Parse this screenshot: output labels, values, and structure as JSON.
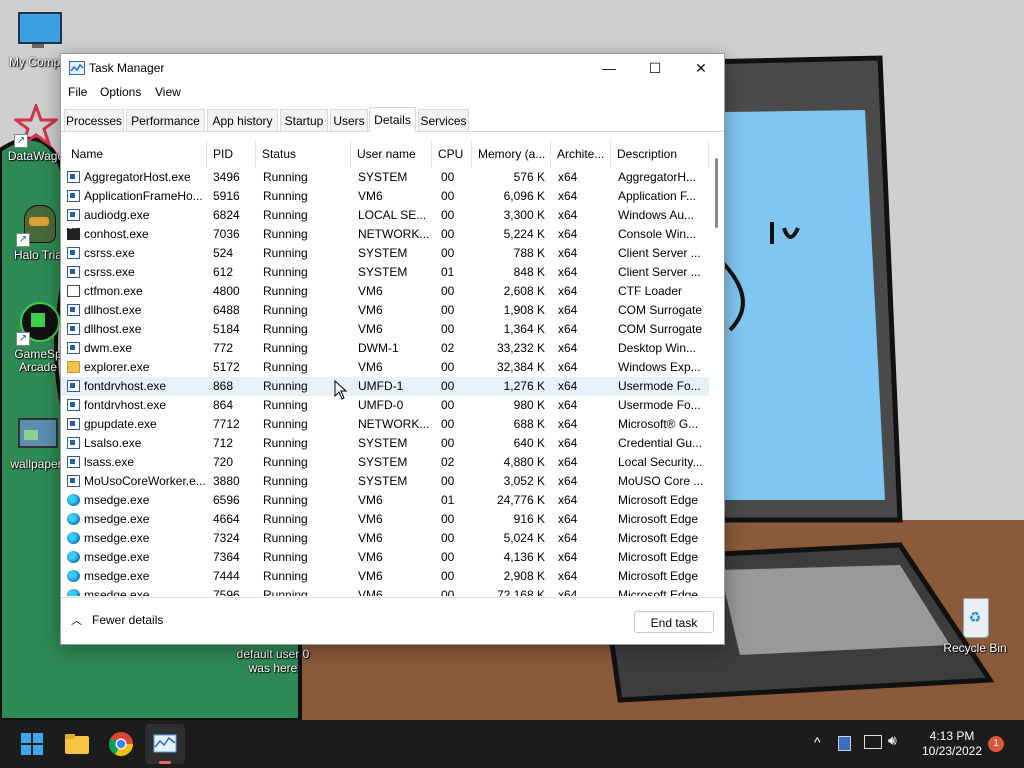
{
  "desktop": {
    "icons": [
      {
        "label": "My Compu",
        "icon": "monitor-icon"
      },
      {
        "label": "DataWago",
        "icon": "red-star-icon"
      },
      {
        "label": "Halo Tria",
        "icon": "helmet-icon"
      },
      {
        "label": "GameSp",
        "label2": "Arcade",
        "icon": "arcade-icon"
      },
      {
        "label": "wallpaper",
        "icon": "picture-icon"
      },
      {
        "label": "Recycle Bin",
        "icon": "recycle-bin-icon"
      }
    ],
    "note_line1": "default user 0",
    "note_line2": "was here"
  },
  "window": {
    "title": "Task Manager",
    "minimize": "—",
    "maximize": "☐",
    "close": "✕",
    "menu": [
      "File",
      "Options",
      "View"
    ],
    "tabs": [
      "Processes",
      "Performance",
      "App history",
      "Startup",
      "Users",
      "Details",
      "Services"
    ],
    "active_tab": "Details",
    "columns": [
      "Name",
      "PID",
      "Status",
      "User name",
      "CPU",
      "Memory (a...",
      "Archite...",
      "Description"
    ],
    "sort_indicator": "^",
    "rows": [
      {
        "icon": "app",
        "name": "AggregatorHost.exe",
        "pid": "3496",
        "status": "Running",
        "user": "SYSTEM",
        "cpu": "00",
        "mem": "576 K",
        "arch": "x64",
        "desc": "AggregatorH..."
      },
      {
        "icon": "app",
        "name": "ApplicationFrameHo...",
        "pid": "5916",
        "status": "Running",
        "user": "VM6",
        "cpu": "00",
        "mem": "6,096 K",
        "arch": "x64",
        "desc": "Application F..."
      },
      {
        "icon": "app",
        "name": "audiodg.exe",
        "pid": "6824",
        "status": "Running",
        "user": "LOCAL SE...",
        "cpu": "00",
        "mem": "3,300 K",
        "arch": "x64",
        "desc": "Windows Au..."
      },
      {
        "icon": "console",
        "name": "conhost.exe",
        "pid": "7036",
        "status": "Running",
        "user": "NETWORK...",
        "cpu": "00",
        "mem": "5,224 K",
        "arch": "x64",
        "desc": "Console Win..."
      },
      {
        "icon": "app",
        "name": "csrss.exe",
        "pid": "524",
        "status": "Running",
        "user": "SYSTEM",
        "cpu": "00",
        "mem": "788 K",
        "arch": "x64",
        "desc": "Client Server ..."
      },
      {
        "icon": "app",
        "name": "csrss.exe",
        "pid": "612",
        "status": "Running",
        "user": "SYSTEM",
        "cpu": "01",
        "mem": "848 K",
        "arch": "x64",
        "desc": "Client Server ..."
      },
      {
        "icon": "edit",
        "name": "ctfmon.exe",
        "pid": "4800",
        "status": "Running",
        "user": "VM6",
        "cpu": "00",
        "mem": "2,608 K",
        "arch": "x64",
        "desc": "CTF Loader"
      },
      {
        "icon": "app",
        "name": "dllhost.exe",
        "pid": "6488",
        "status": "Running",
        "user": "VM6",
        "cpu": "00",
        "mem": "1,908 K",
        "arch": "x64",
        "desc": "COM Surrogate"
      },
      {
        "icon": "app",
        "name": "dllhost.exe",
        "pid": "5184",
        "status": "Running",
        "user": "VM6",
        "cpu": "00",
        "mem": "1,364 K",
        "arch": "x64",
        "desc": "COM Surrogate"
      },
      {
        "icon": "app",
        "name": "dwm.exe",
        "pid": "772",
        "status": "Running",
        "user": "DWM-1",
        "cpu": "02",
        "mem": "33,232 K",
        "arch": "x64",
        "desc": "Desktop Win..."
      },
      {
        "icon": "folder",
        "name": "explorer.exe",
        "pid": "5172",
        "status": "Running",
        "user": "VM6",
        "cpu": "00",
        "mem": "32,384 K",
        "arch": "x64",
        "desc": "Windows Exp..."
      },
      {
        "icon": "app",
        "name": "fontdrvhost.exe",
        "pid": "868",
        "status": "Running",
        "user": "UMFD-1",
        "cpu": "00",
        "mem": "1,276 K",
        "arch": "x64",
        "desc": "Usermode Fo...",
        "highlighted": true
      },
      {
        "icon": "app",
        "name": "fontdrvhost.exe",
        "pid": "864",
        "status": "Running",
        "user": "UMFD-0",
        "cpu": "00",
        "mem": "980 K",
        "arch": "x64",
        "desc": "Usermode Fo..."
      },
      {
        "icon": "app",
        "name": "gpupdate.exe",
        "pid": "7712",
        "status": "Running",
        "user": "NETWORK...",
        "cpu": "00",
        "mem": "688 K",
        "arch": "x64",
        "desc": "Microsoft® G..."
      },
      {
        "icon": "app",
        "name": "Lsalso.exe",
        "pid": "712",
        "status": "Running",
        "user": "SYSTEM",
        "cpu": "00",
        "mem": "640 K",
        "arch": "x64",
        "desc": "Credential Gu..."
      },
      {
        "icon": "app",
        "name": "lsass.exe",
        "pid": "720",
        "status": "Running",
        "user": "SYSTEM",
        "cpu": "02",
        "mem": "4,880 K",
        "arch": "x64",
        "desc": "Local Security..."
      },
      {
        "icon": "app",
        "name": "MoUsoCoreWorker.e...",
        "pid": "3880",
        "status": "Running",
        "user": "SYSTEM",
        "cpu": "00",
        "mem": "3,052 K",
        "arch": "x64",
        "desc": "MoUSO Core ..."
      },
      {
        "icon": "edge",
        "name": "msedge.exe",
        "pid": "6596",
        "status": "Running",
        "user": "VM6",
        "cpu": "01",
        "mem": "24,776 K",
        "arch": "x64",
        "desc": "Microsoft Edge"
      },
      {
        "icon": "edge",
        "name": "msedge.exe",
        "pid": "4664",
        "status": "Running",
        "user": "VM6",
        "cpu": "00",
        "mem": "916 K",
        "arch": "x64",
        "desc": "Microsoft Edge"
      },
      {
        "icon": "edge",
        "name": "msedge.exe",
        "pid": "7324",
        "status": "Running",
        "user": "VM6",
        "cpu": "00",
        "mem": "5,024 K",
        "arch": "x64",
        "desc": "Microsoft Edge"
      },
      {
        "icon": "edge",
        "name": "msedge.exe",
        "pid": "7364",
        "status": "Running",
        "user": "VM6",
        "cpu": "00",
        "mem": "4,136 K",
        "arch": "x64",
        "desc": "Microsoft Edge"
      },
      {
        "icon": "edge",
        "name": "msedge.exe",
        "pid": "7444",
        "status": "Running",
        "user": "VM6",
        "cpu": "00",
        "mem": "2,908 K",
        "arch": "x64",
        "desc": "Microsoft Edge"
      },
      {
        "icon": "edge",
        "name": "msedge.exe",
        "pid": "7596",
        "status": "Running",
        "user": "VM6",
        "cpu": "00",
        "mem": "72,168 K",
        "arch": "x64",
        "desc": "Microsoft Edge"
      }
    ],
    "fewer_details": "Fewer details",
    "end_task": "End task"
  },
  "taskbar": {
    "apps": [
      "start-icon",
      "file-explorer-icon",
      "chrome-icon",
      "task-manager-icon"
    ],
    "active_app": "task-manager-icon",
    "tray_icons": [
      "chevron-up-icon",
      "tablet-icon",
      "network-icon",
      "volume-icon"
    ],
    "time": "4:13 PM",
    "date": "10/23/2022",
    "notification_count": "1"
  },
  "colors": {
    "accent": "#0067c0",
    "taskbar": "#1c1c1c",
    "row_highlight": "#e8f0fb"
  }
}
